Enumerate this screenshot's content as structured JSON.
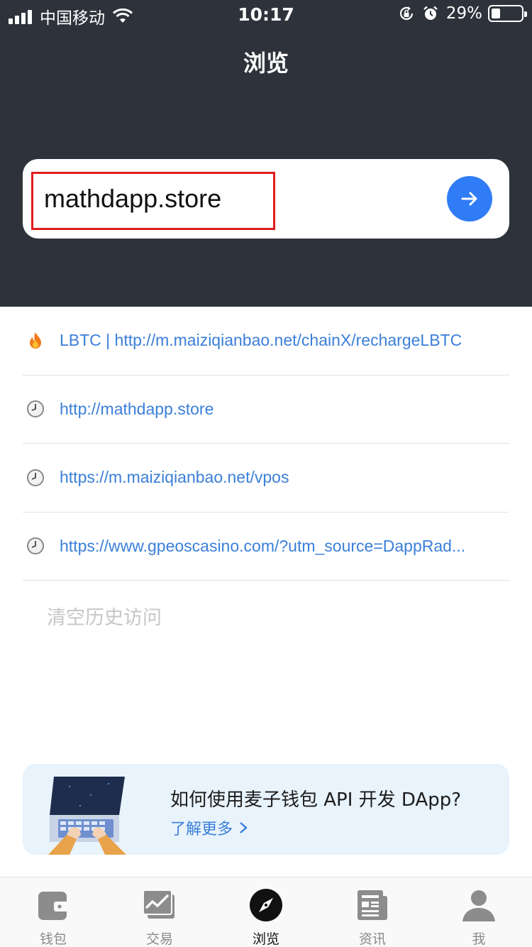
{
  "status_bar": {
    "carrier": "中国移动",
    "time": "10:17",
    "battery_percent": "29%",
    "battery_level": 0.29
  },
  "header": {
    "title": "浏览"
  },
  "search": {
    "value": "mathdapp.store"
  },
  "history": [
    {
      "icon": "fire-icon",
      "text": "LBTC | http://m.maiziqianbao.net/chainX/rechargeLBTC"
    },
    {
      "icon": "clock-icon",
      "text": "http://mathdapp.store"
    },
    {
      "icon": "clock-icon",
      "text": "https://m.maiziqianbao.net/vpos"
    },
    {
      "icon": "clock-icon",
      "text": "https://www.gpeoscasino.com/?utm_source=DappRad..."
    }
  ],
  "clear_history_label": "清空历史访问",
  "banner": {
    "title": "如何使用麦子钱包 API 开发 DApp?",
    "link": "了解更多"
  },
  "tabs": [
    {
      "label": "钱包",
      "icon": "wallet-icon"
    },
    {
      "label": "交易",
      "icon": "chart-icon"
    },
    {
      "label": "浏览",
      "icon": "compass-icon",
      "active": true
    },
    {
      "label": "资讯",
      "icon": "news-icon"
    },
    {
      "label": "我",
      "icon": "person-icon"
    }
  ],
  "colors": {
    "header_bg": "#2e333b",
    "accent": "#2f7cf6",
    "link": "#3b7fd9",
    "highlight": "#e21c1c"
  }
}
